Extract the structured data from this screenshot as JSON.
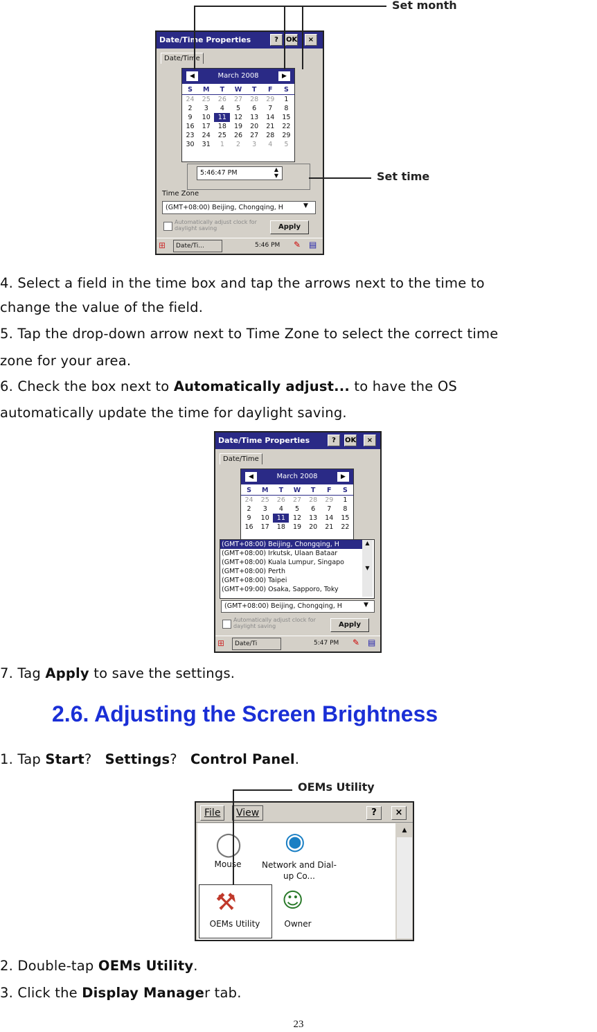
{
  "shot1": {
    "window_title": "Date/Time Properties",
    "help_btn": "?",
    "ok_btn": "OK",
    "close_btn": "×",
    "tab": "Date/Time",
    "month": "March 2008",
    "dow": [
      "S",
      "M",
      "T",
      "W",
      "T",
      "F",
      "S"
    ],
    "weeks": [
      [
        "24",
        "25",
        "26",
        "27",
        "28",
        "29",
        "1"
      ],
      [
        "2",
        "3",
        "4",
        "5",
        "6",
        "7",
        "8"
      ],
      [
        "9",
        "10",
        "11",
        "12",
        "13",
        "14",
        "15"
      ],
      [
        "16",
        "17",
        "18",
        "19",
        "20",
        "21",
        "22"
      ],
      [
        "23",
        "24",
        "25",
        "26",
        "27",
        "28",
        "29"
      ],
      [
        "30",
        "31",
        "1",
        "2",
        "3",
        "4",
        "5"
      ]
    ],
    "time": "5:46:47 PM",
    "timezone_label": "Time Zone",
    "timezone_value": "(GMT+08:00) Beijing, Chongqing, H",
    "auto_adjust": "Automatically adjust clock for daylight saving",
    "apply_btn": "Apply",
    "taskbar_app": "Date/Ti...",
    "taskbar_clock": "5:46 PM",
    "callout_month": "Set month",
    "callout_time": "Set time"
  },
  "p4": "4. Select a field in the time box and tap the arrows next to the time to",
  "p4b": "change the value of the field.",
  "p5": "5. Tap the drop-down arrow next to Time Zone to select the correct time",
  "p5b": "zone for your area.",
  "p6_pre": "6. Check the box next to ",
  "p6_bold": "Automatically adjust...",
  "p6_post": " to have the OS",
  "p6b": "automatically update the time for daylight saving.",
  "shot2": {
    "window_title": "Date/Time Properties",
    "tab": "Date/Time",
    "month": "March 2008",
    "weeks": [
      [
        "24",
        "25",
        "26",
        "27",
        "28",
        "29",
        "1"
      ],
      [
        "2",
        "3",
        "4",
        "5",
        "6",
        "7",
        "8"
      ],
      [
        "9",
        "10",
        "11",
        "12",
        "13",
        "14",
        "15"
      ],
      [
        "16",
        "17",
        "18",
        "19",
        "20",
        "21",
        "22"
      ]
    ],
    "tz_options": [
      "(GMT+08:00) Beijing, Chongqing, H",
      "(GMT+08:00) Irkutsk, Ulaan Bataar",
      "(GMT+08:00) Kuala Lumpur, Singapo",
      "(GMT+08:00) Perth",
      "(GMT+08:00) Taipei",
      "(GMT+09:00) Osaka, Sapporo, Toky"
    ],
    "tz_selected": "(GMT+08:00) Beijing, Chongqing, H",
    "auto_adjust": "Automatically adjust clock for daylight saving",
    "apply_btn": "Apply",
    "taskbar_app": "Date/Ti",
    "taskbar_clock": "5:47 PM"
  },
  "p7_pre": "7. Tag ",
  "p7_bold": "Apply",
  "p7_post": " to save the settings.",
  "heading": "2.6. Adjusting the Screen Brightness",
  "s1_pre": "1. Tap ",
  "s1_b1": "Start",
  "s1_sep1": "?   ",
  "s1_b2": "Settings",
  "s1_sep2": "?   ",
  "s1_b3": "Control Panel",
  "s1_end": ".",
  "shot3": {
    "menu_file": "File",
    "menu_view": "View",
    "help_btn": "?",
    "close_btn": "×",
    "icons": [
      "Mouse",
      "Network and Dial-up Co...",
      "OEMs Utility",
      "Owner"
    ],
    "callout": "OEMs Utility"
  },
  "s2_pre": "2. Double-tap ",
  "s2_bold": "OEMs Utility",
  "s2_end": ".",
  "s3_pre": "3. Click the ",
  "s3_bold": "Display Manage",
  "s3_end": "r tab.",
  "page_number": "23"
}
